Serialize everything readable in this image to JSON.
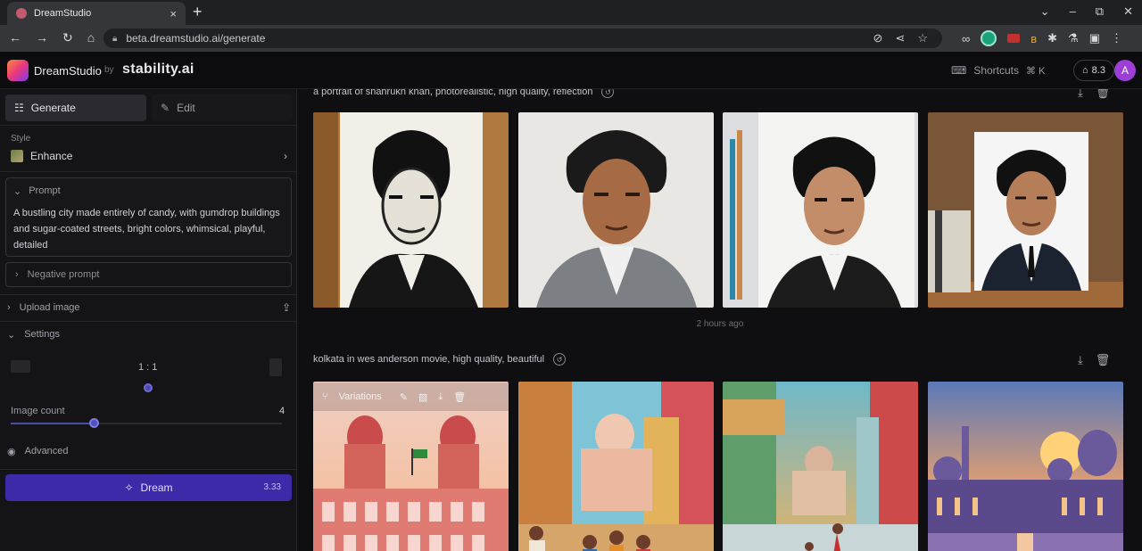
{
  "browser": {
    "tab_title": "DreamStudio",
    "new_tab_symbol": "+",
    "tab_close": "×",
    "url": "beta.dreamstudio.ai/generate",
    "window_controls": [
      "⌄",
      "–",
      "⧉",
      "✕"
    ]
  },
  "header": {
    "brand": "DreamStudio",
    "by": "by",
    "company": "stability.ai",
    "shortcuts_label": "Shortcuts",
    "shortcut_keys": "⌘ K",
    "credits": "8.3",
    "avatar_letter": "A"
  },
  "sidebar": {
    "tabs": [
      {
        "label": "Generate",
        "icon": "sliders-icon"
      },
      {
        "label": "Edit",
        "icon": "edit-icon"
      }
    ],
    "style_label": "Style",
    "style_value": "Enhance",
    "prompt_label": "Prompt",
    "prompt_text": "A bustling city made entirely of candy, with gumdrop buildings and sugar-coated streets, bright colors, whimsical, playful, detailed",
    "negative_prompt_label": "Negative prompt",
    "upload_label": "Upload image",
    "settings_label": "Settings",
    "aspect_ratio": "1 : 1",
    "image_count_label": "Image count",
    "image_count_value": "4",
    "image_count_fraction": 0.31,
    "advanced_label": "Advanced",
    "dream_label": "Dream",
    "dream_cost": "3.33"
  },
  "main": {
    "groups": [
      {
        "caption": "a portrait of shahrukh khan, photorealistic, high quality, reflection",
        "time_ago": "2 hours ago"
      },
      {
        "caption": "kolkata in wes anderson movie, high quality, beautiful"
      }
    ],
    "hover_bar": {
      "label": "Variations"
    }
  },
  "colors": {
    "accent": "#3d2aa8",
    "avatar": "#9b3fd6",
    "background": "#0f0f11",
    "sidebar": "#141417"
  }
}
